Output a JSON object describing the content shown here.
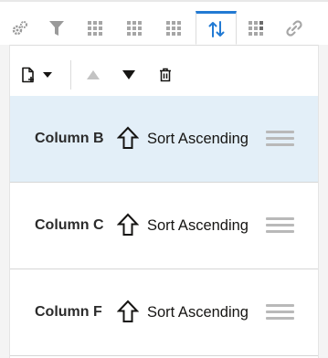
{
  "tabs": [
    {
      "name": "gear-icon",
      "label": "Properties"
    },
    {
      "name": "filter-icon",
      "label": "Filter"
    },
    {
      "name": "grid-icon",
      "label": "Layout"
    },
    {
      "name": "grid-icon",
      "label": "Layout 2"
    },
    {
      "name": "grid-icon",
      "label": "Layout 3"
    },
    {
      "name": "sort-arrows-icon",
      "label": "Sort",
      "active": true
    },
    {
      "name": "grid-colored-icon",
      "label": "Conditional Format"
    },
    {
      "name": "link-icon",
      "label": "Link"
    }
  ],
  "toolbar": {
    "add_icon": "add-document-icon",
    "dropdown_icon": "caret-down-icon",
    "move_up_icon": "triangle-up-icon",
    "move_down_icon": "triangle-down-icon",
    "delete_icon": "trash-icon"
  },
  "rows": [
    {
      "column": "Column B",
      "sort": "Sort Ascending",
      "selected": true
    },
    {
      "column": "Column C",
      "sort": "Sort Ascending",
      "selected": false
    },
    {
      "column": "Column F",
      "sort": "Sort Ascending",
      "selected": false
    }
  ],
  "colors": {
    "accent": "#227ad3",
    "selected_row": "#e3eff8"
  }
}
